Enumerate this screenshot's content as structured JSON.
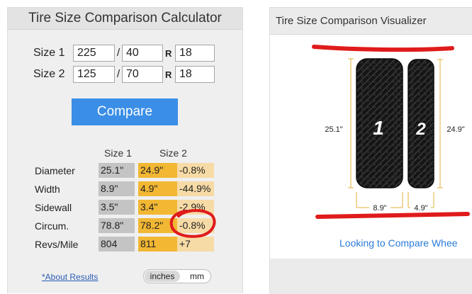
{
  "calculator": {
    "title": "Tire Size Comparison Calculator",
    "size1": {
      "label": "Size 1",
      "width": "225",
      "ratio": "40",
      "rim": "18"
    },
    "size2": {
      "label": "Size 2",
      "width": "125",
      "ratio": "70",
      "rim": "18"
    },
    "slash": "/",
    "r_label": "R",
    "compare_label": "Compare",
    "col_size1": "Size 1",
    "col_size2": "Size 2",
    "rows": [
      {
        "label": "Diameter",
        "s1": "25.1\"",
        "s2": "24.9\"",
        "diff": "-0.8%"
      },
      {
        "label": "Width",
        "s1": "8.9\"",
        "s2": "4.9\"",
        "diff": "-44.9%"
      },
      {
        "label": "Sidewall",
        "s1": "3.5\"",
        "s2": "3.4\"",
        "diff": "-2.9%"
      },
      {
        "label": "Circum.",
        "s1": "78.8\"",
        "s2": "78.2\"",
        "diff": "-0.8%"
      },
      {
        "label": "Revs/Mile",
        "s1": "804",
        "s2": "811",
        "diff": "+7"
      }
    ],
    "about_link": "*About Results",
    "units": {
      "option_a": "inches",
      "option_b": "mm",
      "selected": "inches"
    }
  },
  "visualizer": {
    "title": "Tire Size Comparison Visualizer",
    "tire1_number": "1",
    "tire2_number": "2",
    "dim_left": "25.1\"",
    "dim_right": "24.9\"",
    "dim_width1": "8.9\"",
    "dim_width2": "4.9\"",
    "wheel_link": "Looking to Compare Whee"
  },
  "colors": {
    "annotation": "#e01b1b",
    "button": "#3a8ee6",
    "size2_cell": "#f2b733",
    "diff_cell": "#f7dba6",
    "size1_cell": "#c4c4c4"
  }
}
